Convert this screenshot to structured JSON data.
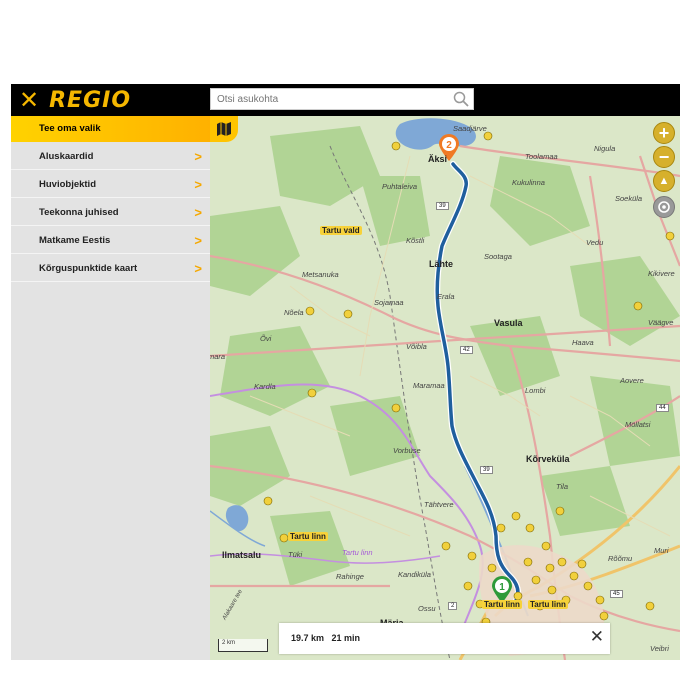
{
  "header": {
    "logo_text": "REGIO",
    "search_placeholder": "Otsi asukohta"
  },
  "sidebar": {
    "active_item": "Tee oma valik",
    "items": [
      {
        "label": "Aluskaardid"
      },
      {
        "label": "Huviobjektid"
      },
      {
        "label": "Teekonna juhised"
      },
      {
        "label": "Matkame Eestis"
      },
      {
        "label": "Kõrguspunktide kaart"
      }
    ]
  },
  "map": {
    "places": {
      "p0": "Saadjärve",
      "p1": "Äksi",
      "p2": "Toolamaa",
      "p3": "Nigula",
      "p4": "Kukulinna",
      "p5": "Soeküla",
      "p6": "Puhtaleiva",
      "p7": "Tartu vald",
      "p8": "Kõstli",
      "p9": "Vedu",
      "p10": "Lähte",
      "p11": "Sootaga",
      "p12": "Metsanuka",
      "p13": "Kikivere",
      "p14": "Sojamaa",
      "p15": "Erala",
      "p16": "Nõela",
      "p17": "Vasula",
      "p18": "Väägve",
      "p19": "Õvi",
      "p20": "Võibla",
      "p21": "Haava",
      "p22": "Kardla",
      "p23": "Maramaa",
      "p24": "Lombi",
      "p25": "Aovere",
      "p26": "Möllatsi",
      "p27": "Vorbuse",
      "p28": "Kõrveküla",
      "p29": "Tila",
      "p30": "Tähtvere",
      "p31": "Tartu linn",
      "p32": "Ilmatsalu",
      "p33": "Tüki",
      "p34": "Tartu linn",
      "p35": "Rõõmu",
      "p36": "Muri",
      "p37": "Rahinge",
      "p38": "Kandiküla",
      "p39": "Ossu",
      "p40": "Tartu linn",
      "p41": "Tartu linn",
      "p42": "Märja",
      "p43": "Veibri",
      "p44": "Alakaare tee",
      "p45": "mara"
    },
    "roads": {
      "r39a": "39",
      "r39b": "39",
      "r42": "42",
      "r44": "44",
      "r45": "45",
      "r2": "2"
    },
    "markers": {
      "start": "1",
      "end": "2"
    },
    "scale": "2 km"
  },
  "route": {
    "distance": "19.7 km",
    "duration": "21 min",
    "close": "✕"
  },
  "colors": {
    "accent": "#f5b700",
    "route": "#1f5f9e",
    "land": "#dbe7c8",
    "forest": "#a8cc8a",
    "water": "#7fa8d6",
    "major_road": "#e5a7a2",
    "highway": "#f0c46a"
  }
}
